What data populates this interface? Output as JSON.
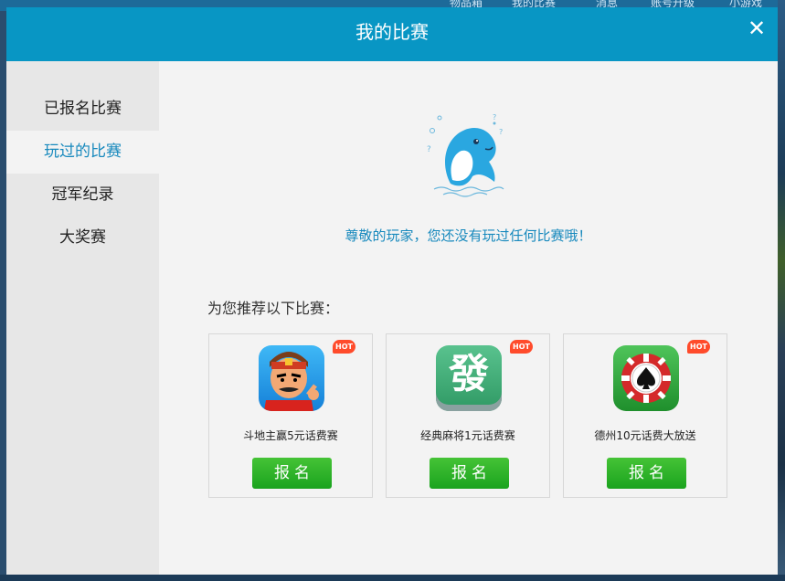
{
  "background_nav": [
    "物品箱",
    "我的比赛",
    "消息",
    "账号升级",
    "小游戏"
  ],
  "dialog": {
    "title": "我的比赛",
    "close_symbol": "✕"
  },
  "sidebar": {
    "items": [
      {
        "label": "已报名比赛",
        "active": false
      },
      {
        "label": "玩过的比赛",
        "active": true
      },
      {
        "label": "冠军纪录",
        "active": false
      },
      {
        "label": "大奖赛",
        "active": false
      }
    ]
  },
  "content": {
    "mascot_icon": "dolphin-mascot-icon",
    "empty_message": "尊敬的玩家，您还没有玩过任何比赛哦！",
    "recommend_label": "为您推荐以下比赛："
  },
  "recommendations": [
    {
      "name": "斗地主赢5元话费赛",
      "hot": "HOT",
      "button": "报名",
      "icon": "doudizhu-landlord-icon"
    },
    {
      "name": "经典麻将1元话费赛",
      "hot": "HOT",
      "button": "报名",
      "icon": "mahjong-fa-tile-icon"
    },
    {
      "name": "德州10元话费大放送",
      "hot": "HOT",
      "button": "报名",
      "icon": "poker-chip-icon"
    }
  ],
  "mahjong_glyph": "發",
  "colors": {
    "header": "#0896c4",
    "accent_text": "#1789bd",
    "button_green": "#2bb52a",
    "hot_badge": "#ff4b2b"
  }
}
